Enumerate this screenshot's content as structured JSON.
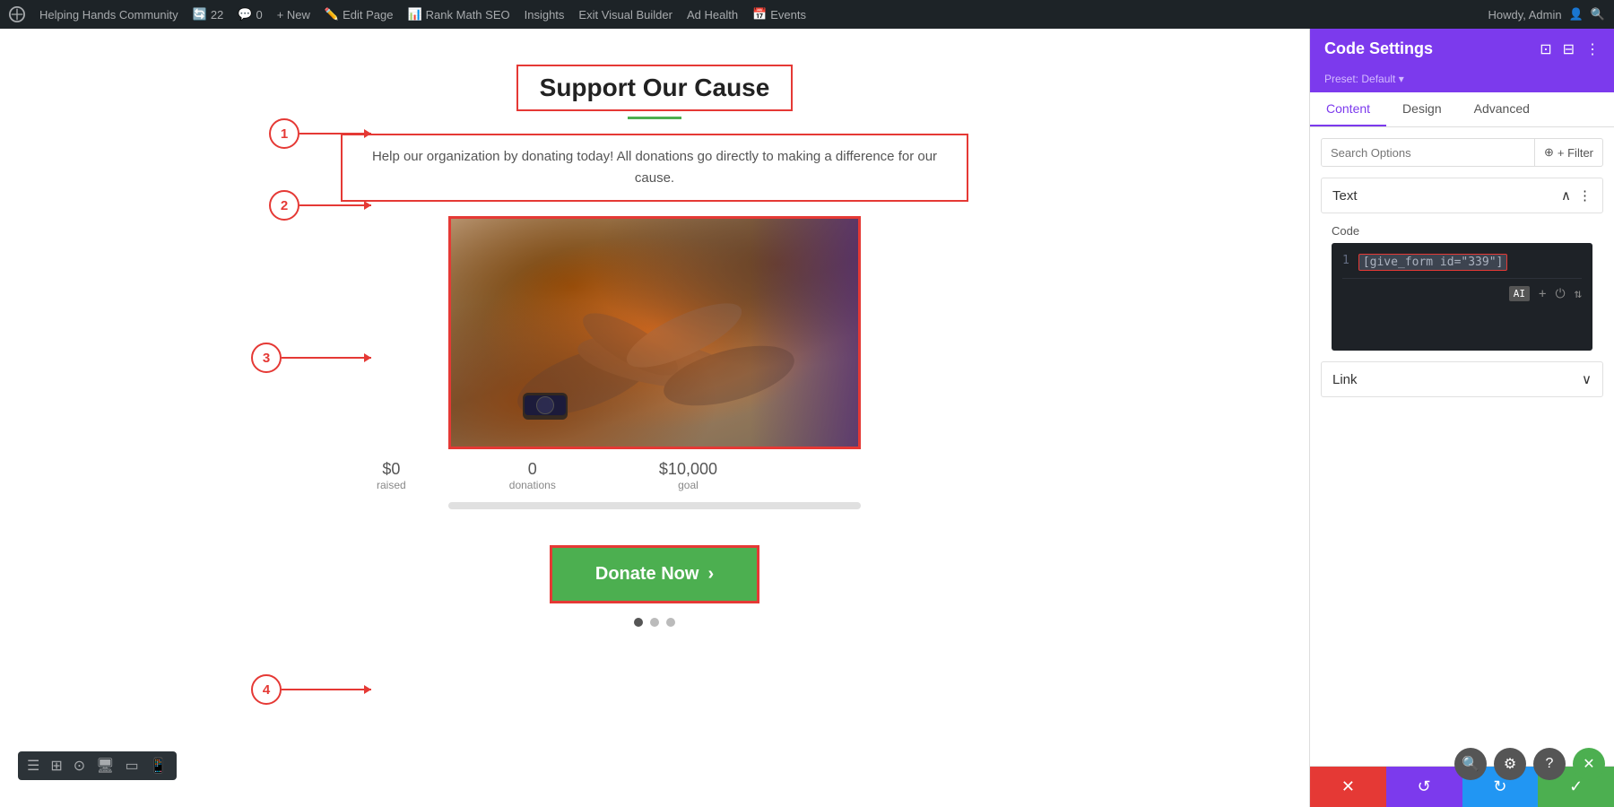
{
  "adminBar": {
    "siteName": "Helping Hands Community",
    "updateCount": "22",
    "commentCount": "0",
    "newLabel": "+ New",
    "editPage": "Edit Page",
    "rankMath": "Rank Math SEO",
    "insights": "Insights",
    "exitBuilder": "Exit Visual Builder",
    "adHealth": "Ad Health",
    "events": "Events",
    "howdy": "Howdy, Admin"
  },
  "page": {
    "title": "Support Our Cause",
    "description": "Help our organization by donating today! All donations go directly to making a difference for our cause.",
    "stats": {
      "raised": "$0",
      "raisedLabel": "raised",
      "donations": "0",
      "donationsLabel": "donations",
      "goal": "$10,000",
      "goalLabel": "goal"
    },
    "donateBtn": "Donate Now",
    "progressPct": 0
  },
  "annotations": {
    "1": "1",
    "2": "2",
    "3": "3",
    "4": "4"
  },
  "panel": {
    "title": "Code Settings",
    "preset": "Preset: Default ▾",
    "tabs": {
      "content": "Content",
      "design": "Design",
      "advanced": "Advanced"
    },
    "searchPlaceholder": "Search Options",
    "filterLabel": "+ Filter",
    "textSection": "Text",
    "codeLabel": "Code",
    "codeValue": "[give_form id=\"339\"]",
    "lineNum": "1",
    "linkSection": "Link"
  },
  "toolbar": {
    "icons": [
      "≡",
      "⊞",
      "🔍",
      "🖥",
      "📱",
      "📲"
    ]
  },
  "floatButtons": [
    "🔍",
    "↻",
    "?",
    "✕"
  ]
}
